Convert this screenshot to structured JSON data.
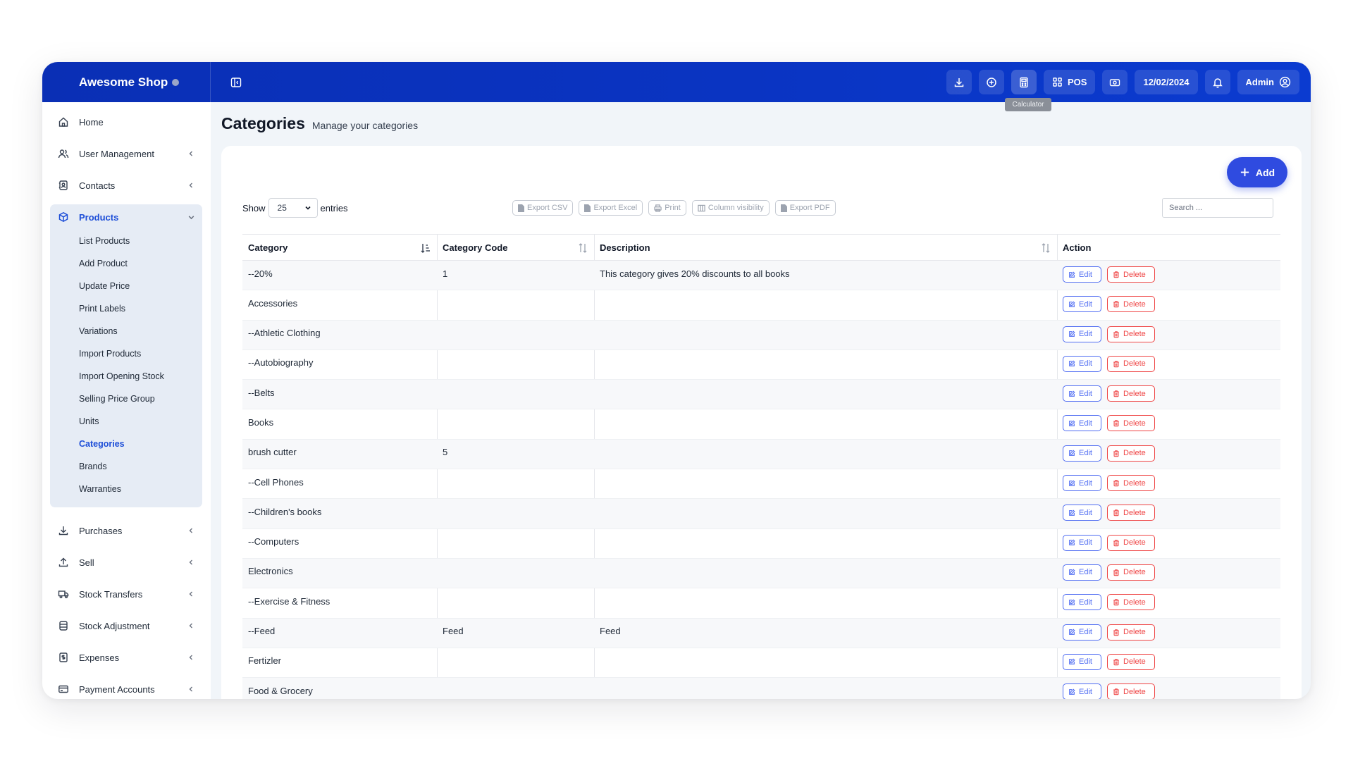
{
  "brand": {
    "name": "Awesome Shop"
  },
  "header": {
    "pos_label": "POS",
    "date": "12/02/2024",
    "user": "Admin",
    "tooltip": "Calculator"
  },
  "sidebar": {
    "items": [
      {
        "label": "Home",
        "icon": "home-icon"
      },
      {
        "label": "User Management",
        "icon": "users-icon"
      },
      {
        "label": "Contacts",
        "icon": "contacts-icon"
      },
      {
        "label": "Products",
        "icon": "cube-icon"
      },
      {
        "label": "Purchases",
        "icon": "download-icon"
      },
      {
        "label": "Sell",
        "icon": "upload-icon"
      },
      {
        "label": "Stock Transfers",
        "icon": "truck-icon"
      },
      {
        "label": "Stock Adjustment",
        "icon": "database-icon"
      },
      {
        "label": "Expenses",
        "icon": "receipt-icon"
      },
      {
        "label": "Payment Accounts",
        "icon": "card-icon"
      }
    ],
    "products_sub": [
      "List Products",
      "Add Product",
      "Update Price",
      "Print Labels",
      "Variations",
      "Import Products",
      "Import Opening Stock",
      "Selling Price Group",
      "Units",
      "Categories",
      "Brands",
      "Warranties"
    ]
  },
  "page": {
    "title": "Categories",
    "subtitle": "Manage your categories",
    "add_label": "Add"
  },
  "controls": {
    "show_label": "Show",
    "entries_value": "25",
    "entries_label": "entries",
    "export_csv": "Export CSV",
    "export_excel": "Export Excel",
    "print": "Print",
    "column_visibility": "Column visibility",
    "export_pdf": "Export PDF",
    "search_placeholder": "Search ..."
  },
  "table": {
    "columns": [
      "Category",
      "Category Code",
      "Description",
      "Action"
    ],
    "edit_label": "Edit",
    "delete_label": "Delete",
    "rows": [
      {
        "category": "--20%",
        "code": "1",
        "description": "This category gives 20% discounts to all books"
      },
      {
        "category": "Accessories",
        "code": "",
        "description": ""
      },
      {
        "category": "--Athletic Clothing",
        "code": "",
        "description": ""
      },
      {
        "category": "--Autobiography",
        "code": "",
        "description": ""
      },
      {
        "category": "--Belts",
        "code": "",
        "description": ""
      },
      {
        "category": "Books",
        "code": "",
        "description": ""
      },
      {
        "category": "brush cutter",
        "code": "5",
        "description": ""
      },
      {
        "category": "--Cell Phones",
        "code": "",
        "description": ""
      },
      {
        "category": "--Children's books",
        "code": "",
        "description": ""
      },
      {
        "category": "--Computers",
        "code": "",
        "description": ""
      },
      {
        "category": "Electronics",
        "code": "",
        "description": ""
      },
      {
        "category": "--Exercise & Fitness",
        "code": "",
        "description": ""
      },
      {
        "category": "--Feed",
        "code": "Feed",
        "description": "Feed"
      },
      {
        "category": "Fertizler",
        "code": "",
        "description": ""
      },
      {
        "category": "Food & Grocery",
        "code": "",
        "description": ""
      }
    ]
  },
  "colors": {
    "topbar": "#0a34c2",
    "accent": "#2f4be0",
    "active_link": "#1d4ed8",
    "edit": "#4f6cf2",
    "delete": "#ef4444"
  }
}
